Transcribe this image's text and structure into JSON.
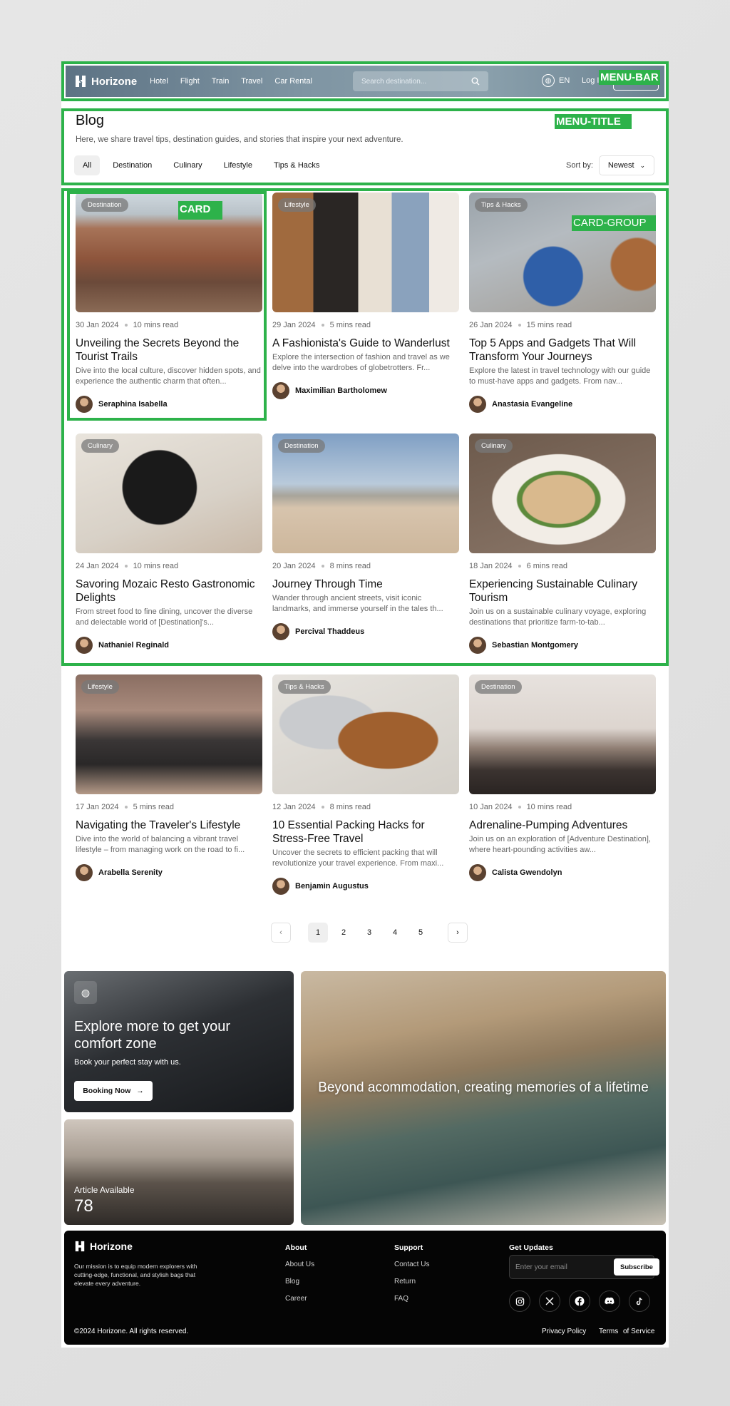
{
  "annotations": {
    "menu_bar": "MENU-BAR",
    "menu_title": "MENU-TITLE",
    "card": "CARD",
    "card_group": "CARD-GROUP"
  },
  "header": {
    "brand": "Horizone",
    "nav": [
      "Hotel",
      "Flight",
      "Train",
      "Travel",
      "Car Rental"
    ],
    "search_placeholder": "Search destination...",
    "language": "EN",
    "login": "Log In"
  },
  "blog": {
    "title": "Blog",
    "subtitle": "Here, we share travel tips, destination guides, and stories that inspire your next adventure.",
    "filters": [
      "All",
      "Destination",
      "Culinary",
      "Lifestyle",
      "Tips & Hacks"
    ],
    "sort_label": "Sort by:",
    "sort_value": "Newest"
  },
  "posts": [
    {
      "category": "Destination",
      "date": "30 Jan 2024",
      "read": "10 mins read",
      "title": "Unveiling the Secrets Beyond the Tourist Trails",
      "excerpt": "Dive into the local culture, discover hidden spots, and experience the authentic charm that often...",
      "author": "Seraphina Isabella"
    },
    {
      "category": "Lifestyle",
      "date": "29 Jan 2024",
      "read": "5 mins read",
      "title": "A Fashionista's Guide to Wanderlust",
      "excerpt": "Explore the intersection of fashion and travel as we delve into the wardrobes of globetrotters. Fr...",
      "author": "Maximilian Bartholomew"
    },
    {
      "category": "Tips & Hacks",
      "date": "26 Jan 2024",
      "read": "15 mins read",
      "title": "Top 5 Apps and Gadgets That Will Transform Your Journeys",
      "excerpt": "Explore the latest in travel technology with our guide to must-have apps and gadgets. From nav...",
      "author": "Anastasia Evangeline"
    },
    {
      "category": "Culinary",
      "date": "24 Jan 2024",
      "read": "10 mins read",
      "title": "Savoring Mozaic Resto Gastronomic Delights",
      "excerpt": "From street food to fine dining, uncover the diverse and delectable world of [Destination]'s...",
      "author": "Nathaniel Reginald"
    },
    {
      "category": "Destination",
      "date": "20 Jan 2024",
      "read": "8 mins read",
      "title": "Journey Through Time",
      "excerpt": "Wander through ancient streets, visit iconic landmarks, and immerse yourself in the tales th...",
      "author": "Percival Thaddeus"
    },
    {
      "category": "Culinary",
      "date": "18 Jan 2024",
      "read": "6 mins read",
      "title": "Experiencing Sustainable Culinary Tourism",
      "excerpt": "Join us on a sustainable culinary voyage, exploring destinations that prioritize farm-to-tab...",
      "author": "Sebastian Montgomery"
    },
    {
      "category": "Lifestyle",
      "date": "17 Jan 2024",
      "read": "5 mins read",
      "title": "Navigating the Traveler's Lifestyle",
      "excerpt": "Dive into the world of balancing a vibrant travel lifestyle – from managing work on the road to fi...",
      "author": "Arabella Serenity"
    },
    {
      "category": "Tips & Hacks",
      "date": "12 Jan 2024",
      "read": "8 mins read",
      "title": "10 Essential Packing Hacks for Stress-Free Travel",
      "excerpt": "Uncover the secrets to efficient packing that will revolutionize your travel experience. From maxi...",
      "author": "Benjamin Augustus"
    },
    {
      "category": "Destination",
      "date": "10 Jan 2024",
      "read": "10 mins read",
      "title": "Adrenaline-Pumping Adventures",
      "excerpt": "Join us on an exploration of [Adventure Destination], where heart-pounding activities aw...",
      "author": "Calista Gwendolyn"
    }
  ],
  "pagination": {
    "pages": [
      "1",
      "2",
      "3",
      "4",
      "5"
    ],
    "current": "1"
  },
  "promo": {
    "headline": "Explore more to get your comfort zone",
    "subline": "Book your perfect stay with us.",
    "button": "Booking Now",
    "article_label": "Article Available",
    "article_count": "78",
    "caption": "Beyond acommodation, creating memories of a lifetime"
  },
  "footer": {
    "brand": "Horizone",
    "mission": "Our mission is to equip modern explorers with cutting-edge, functional, and stylish bags that elevate every adventure.",
    "about_heading": "About",
    "about_links": [
      "About Us",
      "Blog",
      "Career"
    ],
    "support_heading": "Support",
    "support_links": [
      "Contact Us",
      "Return",
      "FAQ"
    ],
    "updates_heading": "Get Updates",
    "email_placeholder": "Enter your email",
    "subscribe": "Subscribe",
    "socials": [
      "instagram-icon",
      "x-icon",
      "facebook-icon",
      "discord-icon",
      "tiktok-icon"
    ],
    "copyright": "©2024 Horizone. All rights reserved.",
    "privacy": "Privacy Policy",
    "terms": "Terms",
    "terms_of_service": "of Service"
  }
}
